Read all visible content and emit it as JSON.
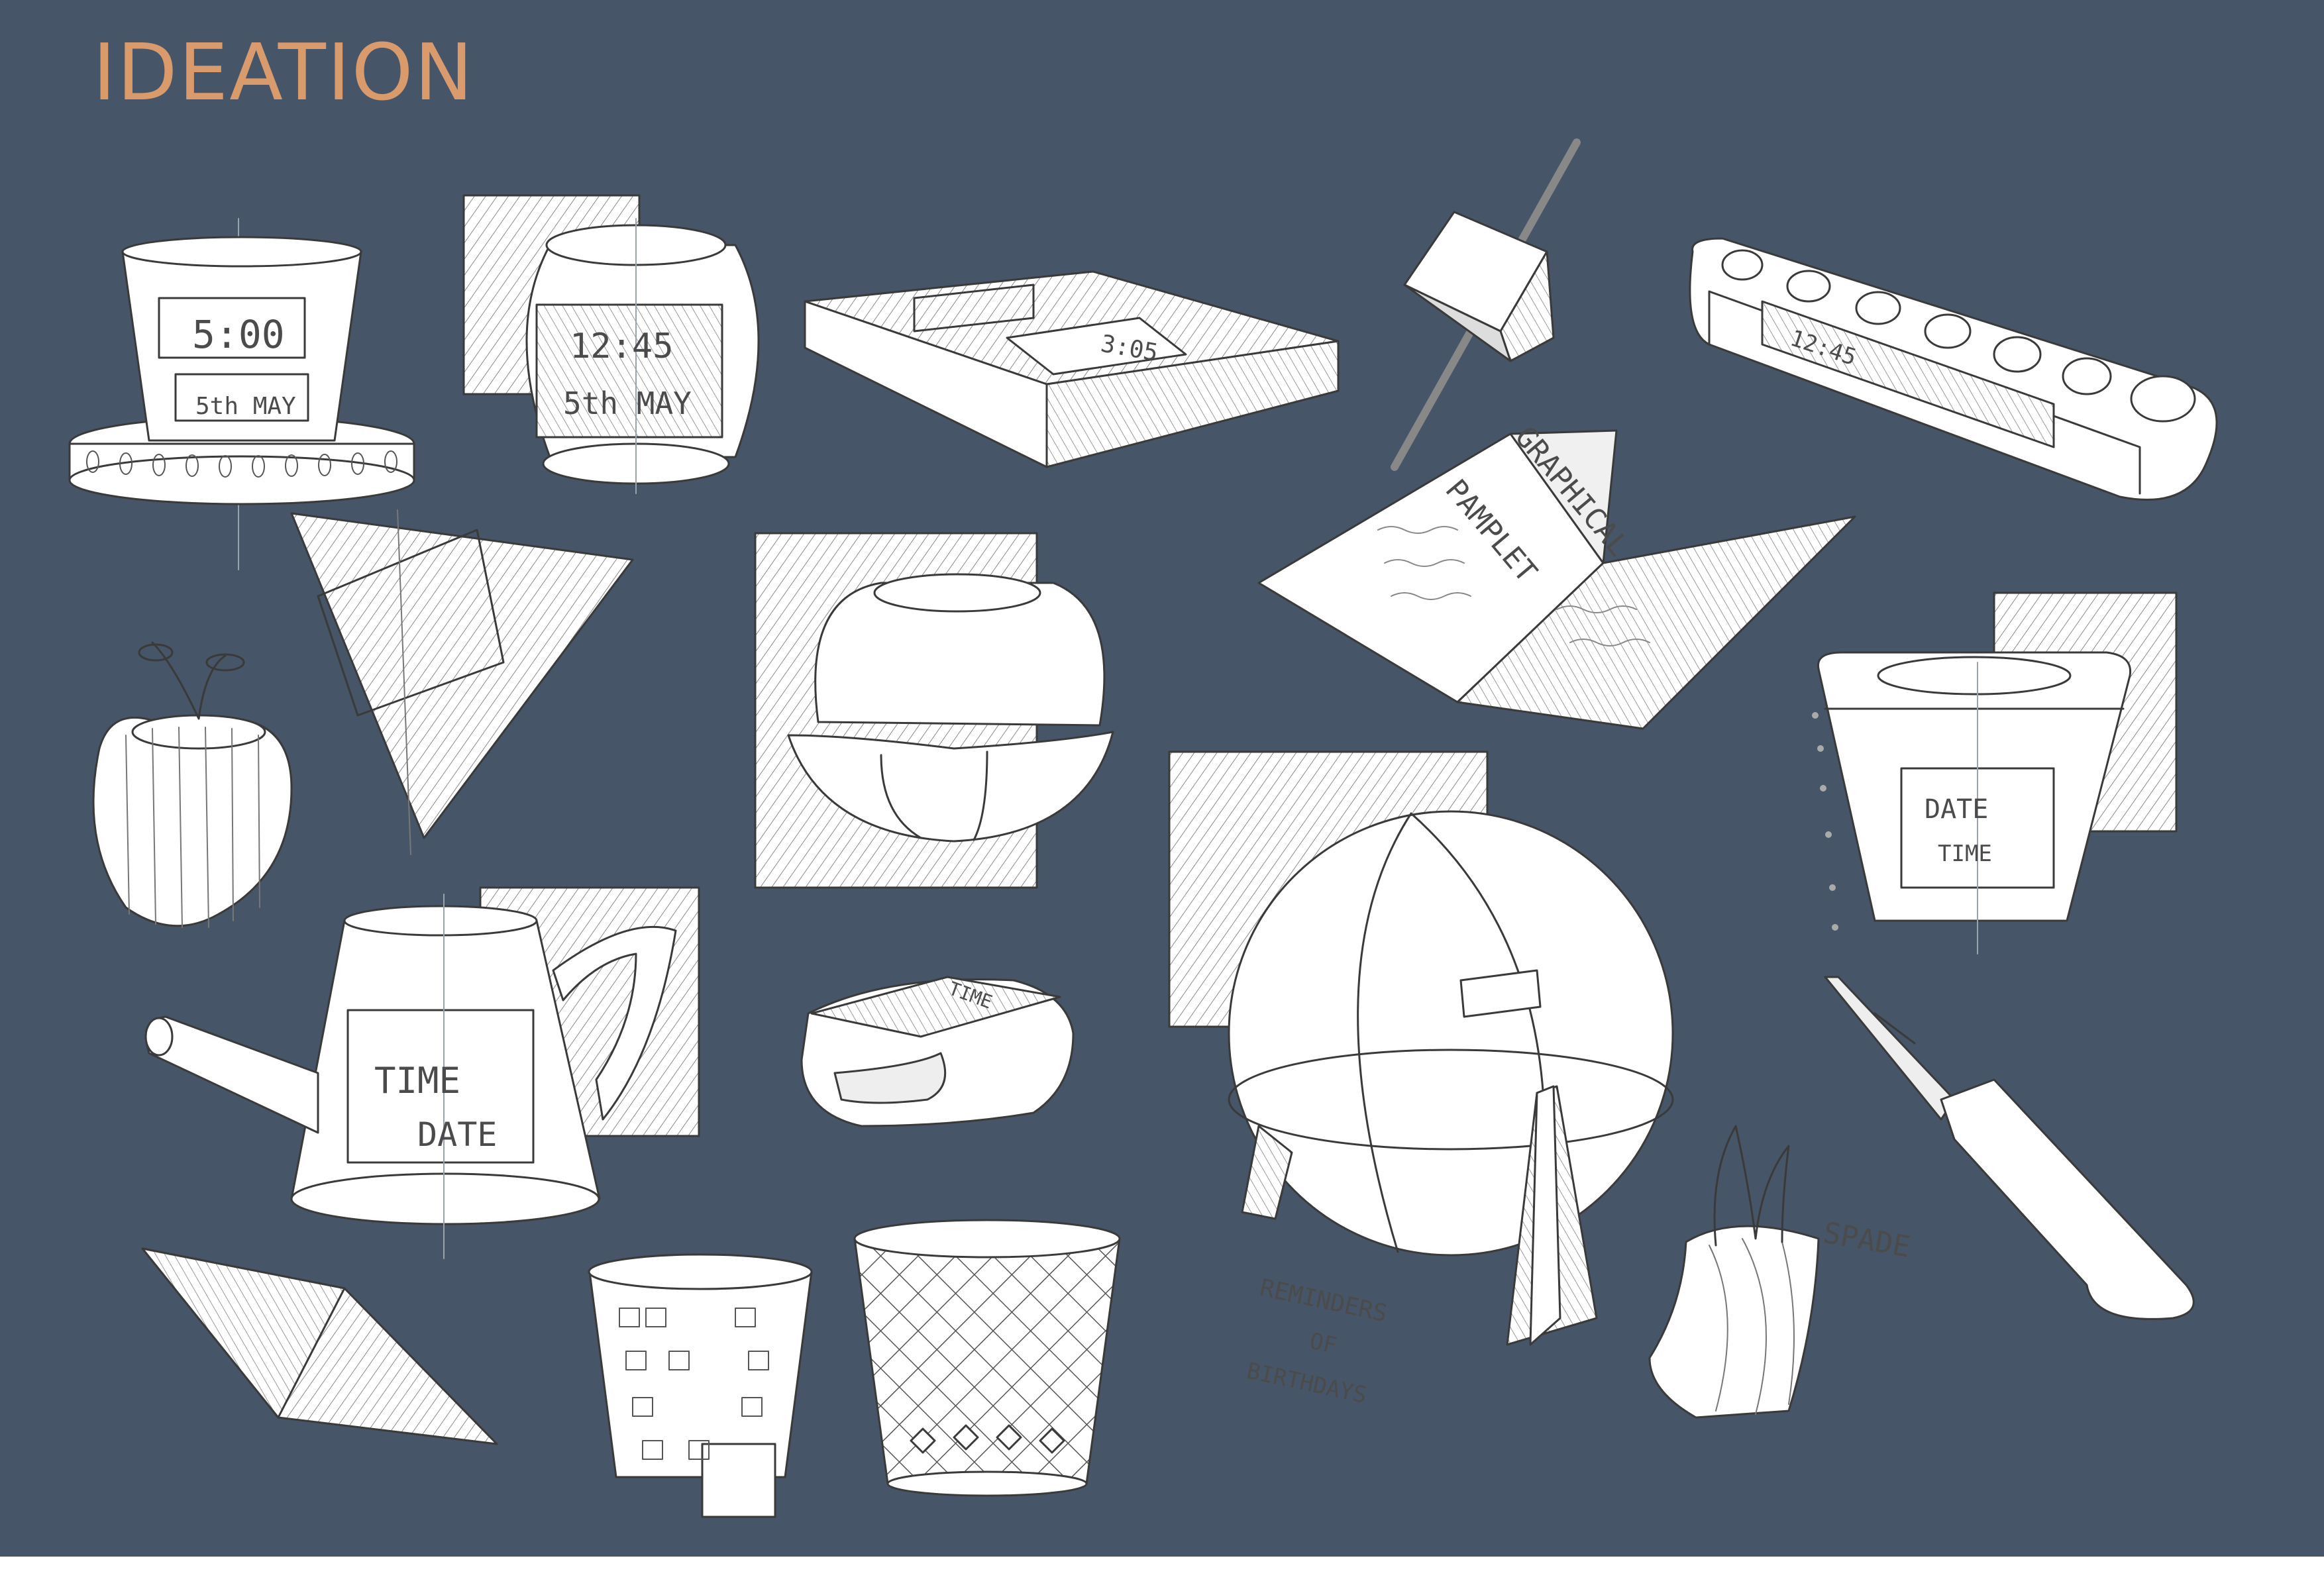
{
  "page": {
    "title": "IDEATION",
    "colors": {
      "board": "#475569",
      "title": "#d99a6c",
      "sketch_fill": "#ffffff",
      "sketch_line": "#3a3a3a"
    }
  },
  "labels": {
    "pot1_time": "5:00",
    "pot1_date": "5th MAY",
    "mug_time": "12:45",
    "mug_date": "5th MAY",
    "tray_time": "3:05",
    "bar_time": "12:45",
    "pamphlet_title1": "GRAPHICAL",
    "pamphlet_title2": "PAMPLET",
    "planter_date": "DATE",
    "planter_time": "TIME",
    "pitcher_time": "TIME",
    "pitcher_date": "DATE",
    "band_time": "TIME",
    "globe_note1": "REMINDERS",
    "globe_note2": "OF",
    "globe_note3": "BIRTHDAYS",
    "spade": "SPADE"
  }
}
